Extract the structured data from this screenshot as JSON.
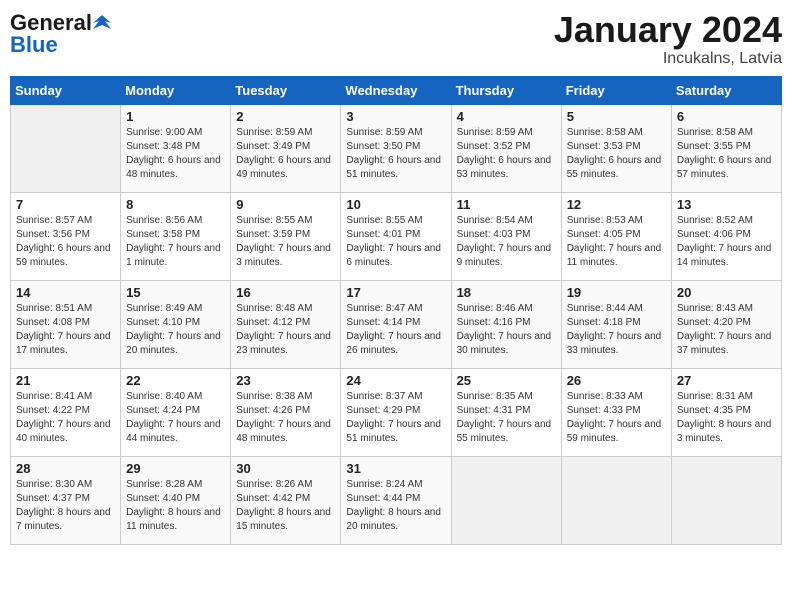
{
  "header": {
    "logo_general": "General",
    "logo_blue": "Blue",
    "month_title": "January 2024",
    "location": "Incukalns, Latvia"
  },
  "days_of_week": [
    "Sunday",
    "Monday",
    "Tuesday",
    "Wednesday",
    "Thursday",
    "Friday",
    "Saturday"
  ],
  "weeks": [
    [
      {
        "day": "",
        "empty": true
      },
      {
        "day": "1",
        "sunrise": "Sunrise: 9:00 AM",
        "sunset": "Sunset: 3:48 PM",
        "daylight": "Daylight: 6 hours and 48 minutes."
      },
      {
        "day": "2",
        "sunrise": "Sunrise: 8:59 AM",
        "sunset": "Sunset: 3:49 PM",
        "daylight": "Daylight: 6 hours and 49 minutes."
      },
      {
        "day": "3",
        "sunrise": "Sunrise: 8:59 AM",
        "sunset": "Sunset: 3:50 PM",
        "daylight": "Daylight: 6 hours and 51 minutes."
      },
      {
        "day": "4",
        "sunrise": "Sunrise: 8:59 AM",
        "sunset": "Sunset: 3:52 PM",
        "daylight": "Daylight: 6 hours and 53 minutes."
      },
      {
        "day": "5",
        "sunrise": "Sunrise: 8:58 AM",
        "sunset": "Sunset: 3:53 PM",
        "daylight": "Daylight: 6 hours and 55 minutes."
      },
      {
        "day": "6",
        "sunrise": "Sunrise: 8:58 AM",
        "sunset": "Sunset: 3:55 PM",
        "daylight": "Daylight: 6 hours and 57 minutes."
      }
    ],
    [
      {
        "day": "7",
        "sunrise": "Sunrise: 8:57 AM",
        "sunset": "Sunset: 3:56 PM",
        "daylight": "Daylight: 6 hours and 59 minutes."
      },
      {
        "day": "8",
        "sunrise": "Sunrise: 8:56 AM",
        "sunset": "Sunset: 3:58 PM",
        "daylight": "Daylight: 7 hours and 1 minute."
      },
      {
        "day": "9",
        "sunrise": "Sunrise: 8:55 AM",
        "sunset": "Sunset: 3:59 PM",
        "daylight": "Daylight: 7 hours and 3 minutes."
      },
      {
        "day": "10",
        "sunrise": "Sunrise: 8:55 AM",
        "sunset": "Sunset: 4:01 PM",
        "daylight": "Daylight: 7 hours and 6 minutes."
      },
      {
        "day": "11",
        "sunrise": "Sunrise: 8:54 AM",
        "sunset": "Sunset: 4:03 PM",
        "daylight": "Daylight: 7 hours and 9 minutes."
      },
      {
        "day": "12",
        "sunrise": "Sunrise: 8:53 AM",
        "sunset": "Sunset: 4:05 PM",
        "daylight": "Daylight: 7 hours and 11 minutes."
      },
      {
        "day": "13",
        "sunrise": "Sunrise: 8:52 AM",
        "sunset": "Sunset: 4:06 PM",
        "daylight": "Daylight: 7 hours and 14 minutes."
      }
    ],
    [
      {
        "day": "14",
        "sunrise": "Sunrise: 8:51 AM",
        "sunset": "Sunset: 4:08 PM",
        "daylight": "Daylight: 7 hours and 17 minutes."
      },
      {
        "day": "15",
        "sunrise": "Sunrise: 8:49 AM",
        "sunset": "Sunset: 4:10 PM",
        "daylight": "Daylight: 7 hours and 20 minutes."
      },
      {
        "day": "16",
        "sunrise": "Sunrise: 8:48 AM",
        "sunset": "Sunset: 4:12 PM",
        "daylight": "Daylight: 7 hours and 23 minutes."
      },
      {
        "day": "17",
        "sunrise": "Sunrise: 8:47 AM",
        "sunset": "Sunset: 4:14 PM",
        "daylight": "Daylight: 7 hours and 26 minutes."
      },
      {
        "day": "18",
        "sunrise": "Sunrise: 8:46 AM",
        "sunset": "Sunset: 4:16 PM",
        "daylight": "Daylight: 7 hours and 30 minutes."
      },
      {
        "day": "19",
        "sunrise": "Sunrise: 8:44 AM",
        "sunset": "Sunset: 4:18 PM",
        "daylight": "Daylight: 7 hours and 33 minutes."
      },
      {
        "day": "20",
        "sunrise": "Sunrise: 8:43 AM",
        "sunset": "Sunset: 4:20 PM",
        "daylight": "Daylight: 7 hours and 37 minutes."
      }
    ],
    [
      {
        "day": "21",
        "sunrise": "Sunrise: 8:41 AM",
        "sunset": "Sunset: 4:22 PM",
        "daylight": "Daylight: 7 hours and 40 minutes."
      },
      {
        "day": "22",
        "sunrise": "Sunrise: 8:40 AM",
        "sunset": "Sunset: 4:24 PM",
        "daylight": "Daylight: 7 hours and 44 minutes."
      },
      {
        "day": "23",
        "sunrise": "Sunrise: 8:38 AM",
        "sunset": "Sunset: 4:26 PM",
        "daylight": "Daylight: 7 hours and 48 minutes."
      },
      {
        "day": "24",
        "sunrise": "Sunrise: 8:37 AM",
        "sunset": "Sunset: 4:29 PM",
        "daylight": "Daylight: 7 hours and 51 minutes."
      },
      {
        "day": "25",
        "sunrise": "Sunrise: 8:35 AM",
        "sunset": "Sunset: 4:31 PM",
        "daylight": "Daylight: 7 hours and 55 minutes."
      },
      {
        "day": "26",
        "sunrise": "Sunrise: 8:33 AM",
        "sunset": "Sunset: 4:33 PM",
        "daylight": "Daylight: 7 hours and 59 minutes."
      },
      {
        "day": "27",
        "sunrise": "Sunrise: 8:31 AM",
        "sunset": "Sunset: 4:35 PM",
        "daylight": "Daylight: 8 hours and 3 minutes."
      }
    ],
    [
      {
        "day": "28",
        "sunrise": "Sunrise: 8:30 AM",
        "sunset": "Sunset: 4:37 PM",
        "daylight": "Daylight: 8 hours and 7 minutes."
      },
      {
        "day": "29",
        "sunrise": "Sunrise: 8:28 AM",
        "sunset": "Sunset: 4:40 PM",
        "daylight": "Daylight: 8 hours and 11 minutes."
      },
      {
        "day": "30",
        "sunrise": "Sunrise: 8:26 AM",
        "sunset": "Sunset: 4:42 PM",
        "daylight": "Daylight: 8 hours and 15 minutes."
      },
      {
        "day": "31",
        "sunrise": "Sunrise: 8:24 AM",
        "sunset": "Sunset: 4:44 PM",
        "daylight": "Daylight: 8 hours and 20 minutes."
      },
      {
        "day": "",
        "empty": true
      },
      {
        "day": "",
        "empty": true
      },
      {
        "day": "",
        "empty": true
      }
    ]
  ]
}
